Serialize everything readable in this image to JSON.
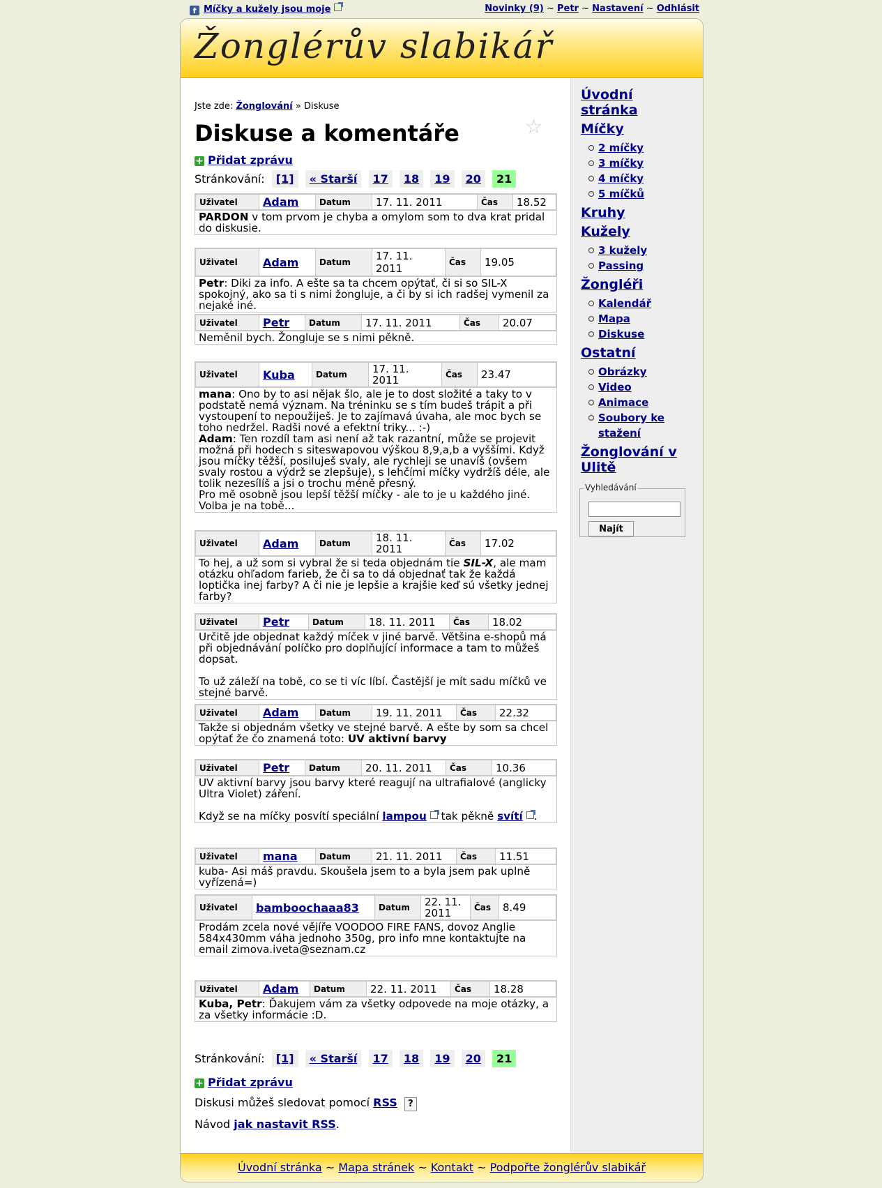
{
  "topbar": {
    "fb_icon": "f",
    "fb_link": "Míčky a kužely jsou moje",
    "news": "Novinky (9)",
    "sep": "~",
    "user": "Petr",
    "settings": "Nastavení",
    "logout": "Odhlásit"
  },
  "site_title": "Žonglérův slabikář",
  "breadcrumb": {
    "prefix": "Jste zde:",
    "link": "Žonglování",
    "sep": "»",
    "current": "Diskuse"
  },
  "page_title": "Diskuse a komentáře",
  "add_message": "Přidat zprávu",
  "pager": {
    "label": "Stránkování:",
    "pages": [
      "[1]",
      "« Starší",
      "17",
      "18",
      "19",
      "20"
    ],
    "current": "21"
  },
  "labels": {
    "user": "Uživatel",
    "date": "Datum",
    "time": "Čas"
  },
  "messages": [
    {
      "user": "Adam",
      "date": "17. 11. 2011",
      "time": "18.52"
    },
    {
      "user": "Adam",
      "date": "17. 11. 2011",
      "time": "19.05"
    },
    {
      "user": "Petr",
      "date": "17. 11. 2011",
      "time": "20.07"
    },
    {
      "user": "Kuba",
      "date": "17. 11. 2011",
      "time": "23.47"
    },
    {
      "user": "Adam",
      "date": "18. 11. 2011",
      "time": "17.02"
    },
    {
      "user": "Petr",
      "date": "18. 11. 2011",
      "time": "18.02"
    },
    {
      "user": "Adam",
      "date": "19. 11. 2011",
      "time": "22.32"
    },
    {
      "user": "Petr",
      "date": "20. 11. 2011",
      "time": "10.36"
    },
    {
      "user": "mana",
      "date": "21. 11. 2011",
      "time": "11.51"
    },
    {
      "user": "bamboochaaa83",
      "date": "22. 11. 2011",
      "time": "8.49"
    },
    {
      "user": "Adam",
      "date": "22. 11. 2011",
      "time": "18.28"
    }
  ],
  "bodies": {
    "m0": {
      "b": "PARDON",
      "t": " v tom prvom je chyba a omylom som to dva krat pridal do diskusie."
    },
    "m1": {
      "b": "Petr",
      "t": ": Diki za info. A ešte sa ta chcem opýtať, či si so SIL-X spokojný, ako sa ti s nimi žongluje, a či by si ich radšej vymenil za nejaké iné."
    },
    "m2": {
      "t": "Neměnil bych. Žongluje se s nimi pěkně."
    },
    "m3": {
      "b1": "mana",
      "t1": ": Ono by to asi nějak šlo, ale je to dost složité a taky to v podstatě nemá význam. Na tréninku se s tím budeš trápit a při vystoupení to nepoužiješ. Je to zajímavá úvaha, ale moc bych se toho nedržel. Radši nové a efektní triky... :-)",
      "b2": "Adam",
      "t2": ": Ten rozdíl tam asi není až tak razantní, může se projevit možná při hodech s siteswapovou výškou 8,9,a,b a vyššími. Když jsou míčky těžší, posiluješ svaly, ale rychleji se unavíš (ovšem svaly rostou a výdrž se zlepšuje), s lehčími míčky vydržíš déle, ale tolik nezesílíš a jsi o trochu méně přesný.",
      "t3": "Pro mě osobně jsou lepší těžší míčky - ale to je u každého jiné.",
      "t4": "Volba je na tobě..."
    },
    "m4": {
      "t1": "To hej, a už som si vybral že si teda objednám tie ",
      "bi": "SIL-X",
      "t2": ", ale mam otázku ohľadom farieb, že či sa to dá objednať tak že každá loptička inej farby? A či nie je lepšie a krajšie keď sú všetky jednej farby?"
    },
    "m5": {
      "t1": "Určitě jde objednat každý míček v jiné barvě. Většina e-shopů má při objednávání políčko pro doplňující informace a tam to můžeš dopsat.",
      "t2": "To už záleží na tobě, co se ti víc líbí. Častější je mít sadu míčků ve stejné barvě."
    },
    "m6": {
      "t": "Takže si objednám všetky ve stejné barvě. A ešte by som sa chcel opýtať že čo znamená toto: ",
      "b": "UV aktivní barvy"
    },
    "m7": {
      "t1": "UV aktivní barvy jsou barvy které reagují na ultrafialové (anglicky Ultra Violet) záření.",
      "t2": "Když se na míčky posvítí speciální ",
      "l1": "lampou",
      "t3": " tak pěkně ",
      "l2": "svítí",
      "t4": "."
    },
    "m8": {
      "t": "kuba- Asi máš pravdu. Skoušela jsem to a byla jsem pak uplně vyřízená=)"
    },
    "m9": {
      "t": "Prodám zcela nové vějíře VOODOO FIRE FANS, dovoz Anglie 584x430mm váha jednoho 350g, pro info mne kontaktujte na email zimova.iveta@seznam.cz"
    },
    "m10": {
      "b": "Kuba, Petr",
      "t": ": Ďakujem vám za všetky odpovede na moje otázky, a za všetky informácie :D."
    }
  },
  "rss": {
    "text": "Diskusi můžeš sledovat pomocí",
    "link": "RSS",
    "help": "?",
    "howto_prefix": "Návod",
    "howto_link": "jak nastavit RSS",
    "howto_suffix": "."
  },
  "sidebar": {
    "home": "Úvodní stránka",
    "balls": "Míčky",
    "balls_items": [
      "2 míčky",
      "3 míčky",
      "4 míčky",
      "5 míčků"
    ],
    "rings": "Kruhy",
    "clubs": "Kužely",
    "clubs_items": [
      "3 kužely",
      "Passing"
    ],
    "jugglers": "Žongléři",
    "jugglers_items": [
      "Kalendář",
      "Mapa",
      "Diskuse"
    ],
    "other": "Ostatní",
    "other_items": [
      "Obrázky",
      "Video",
      "Animace",
      "Soubory ke stažení"
    ],
    "ulita": "Žonglování v Ulitě"
  },
  "search": {
    "legend": "Vyhledávání",
    "placeholder": "",
    "button": "Najít"
  },
  "footer": {
    "home": "Úvodní stránka",
    "map": "Mapa stránek",
    "contact": "Kontakt",
    "support": "Podpořte žonglérův slabikář",
    "sep": "~"
  }
}
